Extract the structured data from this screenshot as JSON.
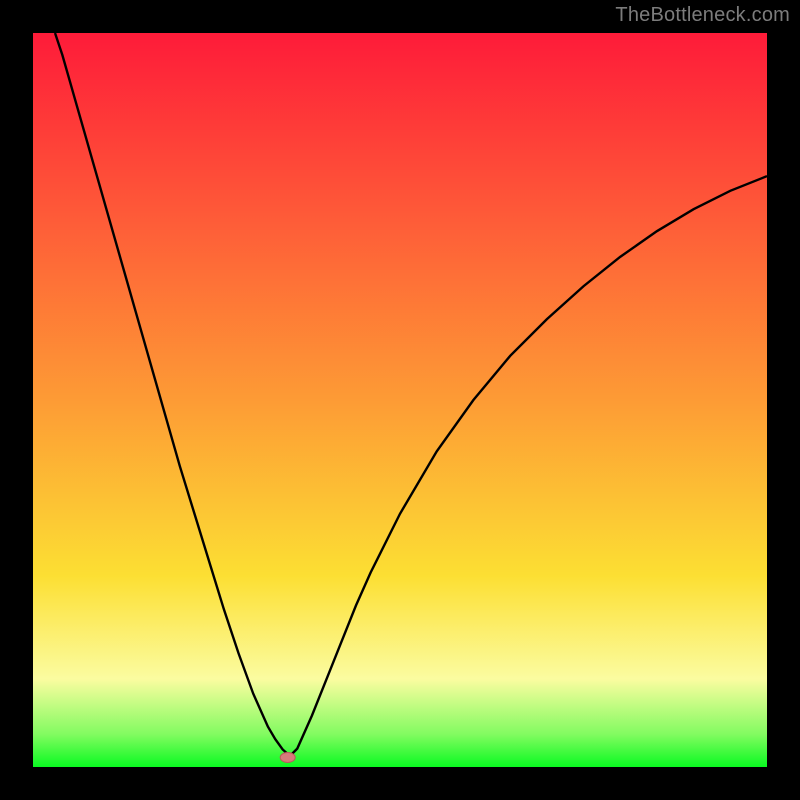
{
  "watermark": "TheBottleneck.com",
  "colors": {
    "top": "#fe1b39",
    "mid_red": "#fe5838",
    "orange": "#fd9b35",
    "yellow": "#fcdf33",
    "pale_yellow": "#fbfca0",
    "light_green": "#83fb61",
    "green": "#0afa21",
    "curve": "#000000",
    "marker_fill": "#d77b7b",
    "marker_stroke": "#bb5a5a",
    "frame": "#000000"
  },
  "chart_data": {
    "type": "line",
    "title": "",
    "xlabel": "",
    "ylabel": "",
    "xlim": [
      0,
      100
    ],
    "ylim": [
      0,
      100
    ],
    "x": [
      3,
      4,
      5,
      6,
      7,
      8,
      9,
      10,
      12,
      14,
      16,
      18,
      20,
      22,
      24,
      26,
      28,
      30,
      32,
      33,
      34,
      35,
      36,
      38,
      40,
      42,
      44,
      46,
      48,
      50,
      55,
      60,
      65,
      70,
      75,
      80,
      85,
      90,
      95,
      100
    ],
    "y": [
      100,
      97,
      93.5,
      90,
      86.5,
      83,
      79.5,
      76,
      69,
      62,
      55,
      48,
      41,
      34.5,
      28,
      21.5,
      15.5,
      10,
      5.5,
      3.8,
      2.4,
      1.5,
      2.5,
      7,
      12,
      17,
      22,
      26.5,
      30.5,
      34.5,
      43,
      50,
      56,
      61,
      65.5,
      69.5,
      73,
      76,
      78.5,
      80.5
    ],
    "marker": {
      "x": 34.7,
      "y": 1.3
    },
    "gradient_stops": [
      {
        "offset": 0,
        "key": "top"
      },
      {
        "offset": 0.24,
        "key": "mid_red"
      },
      {
        "offset": 0.5,
        "key": "orange"
      },
      {
        "offset": 0.74,
        "key": "yellow"
      },
      {
        "offset": 0.88,
        "key": "pale_yellow"
      },
      {
        "offset": 0.955,
        "key": "light_green"
      },
      {
        "offset": 1.0,
        "key": "green"
      }
    ]
  }
}
